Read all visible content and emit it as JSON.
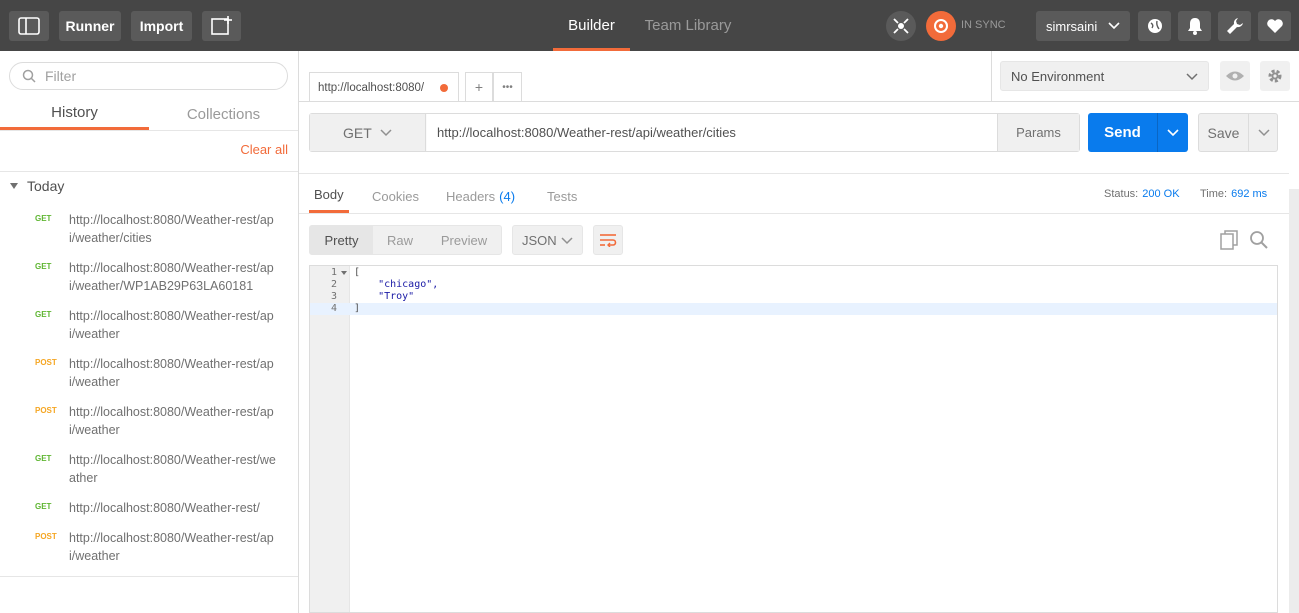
{
  "topbar": {
    "runner_label": "Runner",
    "import_label": "Import",
    "tabs": [
      {
        "label": "Builder",
        "active": true
      },
      {
        "label": "Team Library",
        "active": false
      }
    ],
    "sync_status": "IN SYNC",
    "username": "simrsaini",
    "icons": [
      "sidebar-toggle-icon",
      "new-tab-icon",
      "satellite-icon",
      "sync-icon",
      "globe-icon",
      "bell-icon",
      "wrench-icon",
      "heart-icon"
    ]
  },
  "sidebar": {
    "filter_placeholder": "Filter",
    "tabs": [
      {
        "label": "History",
        "active": true
      },
      {
        "label": "Collections",
        "active": false
      }
    ],
    "clear_all": "Clear all",
    "group_label": "Today",
    "history": [
      {
        "method": "GET",
        "url": "http://localhost:8080/Weather-rest/api/weather/cities"
      },
      {
        "method": "GET",
        "url": "http://localhost:8080/Weather-rest/api/weather/WP1AB29P63LA60181"
      },
      {
        "method": "GET",
        "url": "http://localhost:8080/Weather-rest/api/weather"
      },
      {
        "method": "POST",
        "url": "http://localhost:8080/Weather-rest/api/weather"
      },
      {
        "method": "POST",
        "url": "http://localhost:8080/Weather-rest/api/weather"
      },
      {
        "method": "GET",
        "url": "http://localhost:8080/Weather-rest/weather"
      },
      {
        "method": "GET",
        "url": "http://localhost:8080/Weather-rest/"
      },
      {
        "method": "POST",
        "url": "http://localhost:8080/Weather-rest/api/weather"
      }
    ]
  },
  "request": {
    "tab_label": "http://localhost:8080/",
    "add_tab": "+",
    "more_tabs": "•••",
    "environment": "No Environment",
    "method": "GET",
    "url": "http://localhost:8080/Weather-rest/api/weather/cities",
    "params_label": "Params",
    "send_label": "Send",
    "save_label": "Save"
  },
  "response": {
    "tabs": [
      {
        "label": "Body",
        "active": true
      },
      {
        "label": "Cookies",
        "active": false
      },
      {
        "label": "Headers",
        "count": "(4)",
        "active": false
      },
      {
        "label": "Tests",
        "active": false
      }
    ],
    "status_label": "Status:",
    "status_value": "200 OK",
    "time_label": "Time:",
    "time_value": "692 ms",
    "formats": [
      {
        "label": "Pretty",
        "active": true
      },
      {
        "label": "Raw",
        "active": false
      },
      {
        "label": "Preview",
        "active": false
      }
    ],
    "language": "JSON",
    "body_lines": [
      {
        "num": "1",
        "text": "[",
        "fold": true
      },
      {
        "num": "2",
        "text": "    \"chicago\",",
        "fold": false
      },
      {
        "num": "3",
        "text": "    \"Troy\"",
        "fold": false
      },
      {
        "num": "4",
        "text": "]",
        "fold": false
      }
    ]
  },
  "colors": {
    "accent": "#f26b3a",
    "send_blue": "#097bed",
    "get": "#5fb632",
    "post": "#f5a623"
  }
}
